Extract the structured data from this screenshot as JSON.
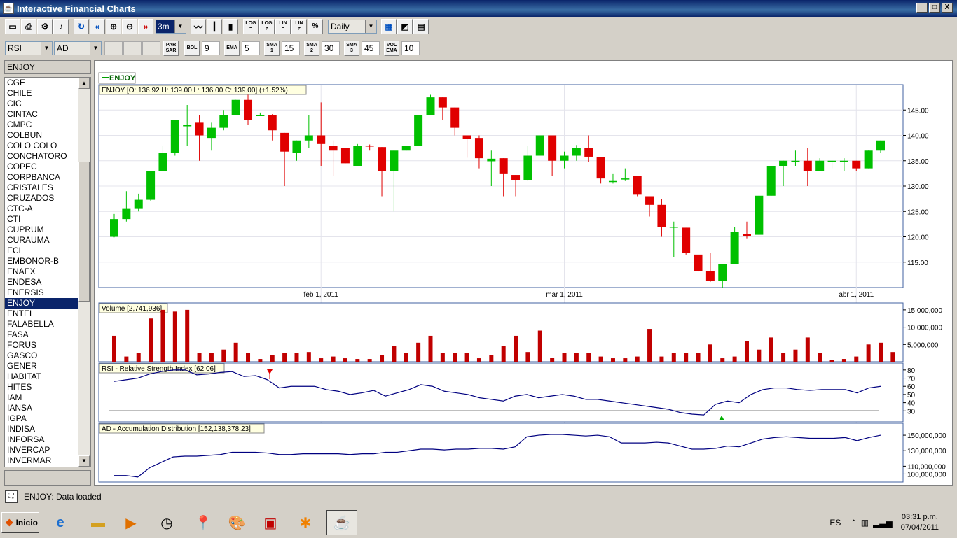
{
  "window": {
    "title": "Interactive Financial Charts",
    "minimize": "_",
    "maximize": "□",
    "close": "X"
  },
  "toolbar1": {
    "period": "3m",
    "log_label": "LOG\n=",
    "log2_label": "LOG\n≠",
    "lin_label": "LIN\n=",
    "lin2_label": "LIN\n≠",
    "pct_label": "%",
    "interval": "Daily"
  },
  "toolbar2": {
    "indicator1": "RSI",
    "indicator2": "AD",
    "parsar": "PAR\nSAR",
    "bol_label": "BOL",
    "bol_value": "9",
    "ema_label": "EMA",
    "ema_value": "5",
    "sma1_label": "SMA\n1",
    "sma1_value": "15",
    "sma2_label": "SMA\n2",
    "sma2_value": "30",
    "sma3_label": "SMA\n3",
    "sma3_value": "45",
    "volema_label": "VOL\nEMA",
    "volema_value": "10"
  },
  "search": {
    "value": "ENJOY"
  },
  "stocks": [
    "CGE",
    "CHILE",
    "CIC",
    "CINTAC",
    "CMPC",
    "COLBUN",
    "COLO COLO",
    "CONCHATORO",
    "COPEC",
    "CORPBANCA",
    "CRISTALES",
    "CRUZADOS",
    "CTC-A",
    "CTI",
    "CUPRUM",
    "CURAUMA",
    "ECL",
    "EMBONOR-B",
    "ENAEX",
    "ENDESA",
    "ENERSIS",
    "ENJOY",
    "ENTEL",
    "FALABELLA",
    "FASA",
    "FORUS",
    "GASCO",
    "GENER",
    "HABITAT",
    "HITES",
    "IAM",
    "IANSA",
    "IGPA",
    "INDISA",
    "INFORSA",
    "INVERCAP",
    "INVERMAR"
  ],
  "selected_stock": "ENJOY",
  "chart": {
    "legend": "ENJOY",
    "price_header": "ENJOY [O: 136.92  H: 139.00  L: 136.00  C: 139.00] (+1.52%)",
    "volume_header": "Volume [2,741,936]",
    "rsi_header": "RSI - Relative Strength Index [62.06]",
    "ad_header": "AD - Accumulation Distribution [152,138,378.23]",
    "x_labels": [
      "feb 1, 2011",
      "mar 1, 2011",
      "abr 1, 2011"
    ],
    "price_ticks": [
      "145.00",
      "140.00",
      "135.00",
      "130.00",
      "125.00",
      "120.00",
      "115.00"
    ],
    "volume_ticks": [
      "15,000,000",
      "10,000,000",
      "5,000,000"
    ],
    "rsi_ticks": [
      "80",
      "70",
      "60",
      "50",
      "40",
      "30"
    ],
    "ad_ticks": [
      "150,000,000",
      "130,000,000",
      "110,000,000",
      "100,000,000"
    ],
    "up_color": "#00c000",
    "down_color": "#e00000",
    "line_color": "#000080"
  },
  "chart_data": {
    "type": "candlestick",
    "candles": [
      [
        120,
        123.5,
        119.9,
        124.5
      ],
      [
        123.5,
        125.5,
        123,
        129
      ],
      [
        125.5,
        127.3,
        125,
        128.5
      ],
      [
        127.3,
        133,
        127,
        133
      ],
      [
        133,
        136.5,
        133,
        138
      ],
      [
        136.5,
        143,
        136,
        143
      ],
      [
        142,
        142,
        138,
        146
      ],
      [
        142.5,
        140,
        135,
        144
      ],
      [
        139.5,
        141.5,
        137,
        142.5
      ],
      [
        141.5,
        144,
        141,
        145
      ],
      [
        144,
        147,
        144,
        147
      ],
      [
        147,
        143,
        142,
        148
      ],
      [
        144,
        144,
        144,
        144.5
      ],
      [
        144,
        141,
        139,
        144.2
      ],
      [
        140.5,
        136.8,
        130,
        140.5
      ],
      [
        136.5,
        139,
        135,
        139
      ],
      [
        139,
        140,
        137.5,
        144
      ],
      [
        140,
        138.3,
        134,
        146.5
      ],
      [
        138,
        137,
        132,
        139
      ],
      [
        137.5,
        134.5,
        134.5,
        137.5
      ],
      [
        134,
        138,
        134,
        138.3
      ],
      [
        138,
        137.8,
        137,
        138.2
      ],
      [
        137.7,
        133,
        128,
        137.7
      ],
      [
        133,
        137,
        125,
        137
      ],
      [
        137,
        137.9,
        137,
        138
      ],
      [
        138,
        144,
        138,
        144
      ],
      [
        144,
        147.5,
        144,
        148
      ],
      [
        147.5,
        145.5,
        143,
        147.5
      ],
      [
        145.5,
        141.5,
        140,
        145.5
      ],
      [
        140,
        139.3,
        135.6,
        140
      ],
      [
        139.5,
        135.5,
        133.5,
        140
      ],
      [
        134.9,
        135.4,
        130,
        137
      ],
      [
        135.5,
        132.5,
        128,
        135.5
      ],
      [
        132.2,
        131.2,
        128,
        132.2
      ],
      [
        131.2,
        136,
        131,
        138
      ],
      [
        136,
        140,
        136,
        140
      ],
      [
        140,
        135,
        132,
        140
      ],
      [
        135,
        136,
        133.5,
        136.8
      ],
      [
        136,
        137.5,
        135,
        138.1
      ],
      [
        137.5,
        135.8,
        134.8,
        140
      ],
      [
        135.7,
        131.5,
        130.5,
        135.7
      ],
      [
        131,
        131,
        130.5,
        132.5
      ],
      [
        131.3,
        131.5,
        131,
        133.5
      ],
      [
        132,
        128.3,
        128,
        132
      ],
      [
        128,
        126.3,
        124,
        128
      ],
      [
        126.3,
        122,
        120,
        127.5
      ],
      [
        122,
        122,
        116,
        123
      ],
      [
        121.8,
        116.8,
        116.5,
        121.8
      ],
      [
        116.5,
        113.3,
        113,
        116.5
      ],
      [
        113.3,
        111.3,
        111.1,
        116.8
      ],
      [
        111.3,
        114.6,
        110,
        114.6
      ],
      [
        114.6,
        121,
        114.6,
        122
      ],
      [
        120.5,
        120.1,
        119.7,
        123
      ],
      [
        120.4,
        128.1,
        120.4,
        128.1
      ],
      [
        128.1,
        134,
        128.1,
        134
      ],
      [
        134,
        135,
        130,
        135
      ],
      [
        135,
        135,
        134,
        137
      ],
      [
        135,
        133,
        130,
        137.5
      ],
      [
        133,
        135,
        133,
        135.5
      ],
      [
        135,
        135,
        133.5,
        135
      ],
      [
        135,
        135,
        133,
        135.5
      ],
      [
        135,
        133.5,
        133,
        135
      ],
      [
        133.5,
        137,
        133.5,
        137
      ],
      [
        137,
        139,
        136.5,
        139
      ]
    ],
    "volume": [
      7.5,
      1.5,
      2.5,
      12.5,
      15,
      14.5,
      15,
      2.5,
      2.5,
      3.5,
      5.5,
      2.5,
      0.8,
      2,
      2.5,
      2.5,
      2.8,
      1,
      1.5,
      1,
      0.8,
      0.8,
      2,
      4.5,
      2.5,
      5.5,
      7.5,
      2.5,
      2.5,
      2.5,
      1,
      2,
      4.5,
      7.5,
      2.8,
      9,
      1.2,
      2.5,
      2.5,
      2.5,
      1.5,
      1,
      1,
      1.5,
      9.5,
      1.5,
      2.5,
      2.5,
      2.5,
      5,
      1,
      1.5,
      6,
      3.5,
      7,
      2.5,
      3.5,
      7,
      2.5,
      0.5,
      0.8,
      1.5,
      5,
      5.5,
      2.8
    ],
    "rsi": [
      66,
      68,
      70,
      75,
      78,
      80,
      80,
      74,
      75,
      77,
      78,
      72,
      73,
      68,
      58,
      60,
      60,
      60,
      56,
      54,
      50,
      52,
      55,
      48,
      52,
      56,
      62,
      60,
      54,
      52,
      50,
      46,
      44,
      42,
      48,
      50,
      46,
      48,
      50,
      48,
      44,
      44,
      42,
      40,
      38,
      36,
      34,
      32,
      28,
      26,
      25,
      38,
      42,
      40,
      50,
      56,
      58,
      58,
      56,
      55,
      56,
      56,
      56,
      52,
      58,
      60
    ],
    "ad": [
      98,
      98,
      96,
      108,
      115,
      122,
      123,
      123,
      124,
      125,
      128,
      128,
      128,
      127,
      125,
      125,
      126,
      126,
      126,
      126,
      125,
      126,
      126,
      128,
      128,
      130,
      132,
      132,
      131,
      132,
      132,
      133,
      133,
      132,
      135,
      148,
      150,
      151,
      151,
      150,
      149,
      150,
      148,
      140,
      140,
      140,
      141,
      140,
      136,
      132,
      132,
      133,
      136,
      135,
      140,
      145,
      147,
      148,
      147,
      146,
      146,
      146,
      147,
      143,
      147,
      150
    ],
    "rsi_levels": [
      70,
      30
    ],
    "price_range": [
      110,
      150
    ],
    "volume_range": [
      0,
      17000000
    ]
  },
  "status": {
    "text": "ENJOY: Data loaded"
  },
  "taskbar": {
    "start": "Inicio",
    "lang": "ES",
    "time": "03:31 p.m.",
    "date": "07/04/2011"
  }
}
